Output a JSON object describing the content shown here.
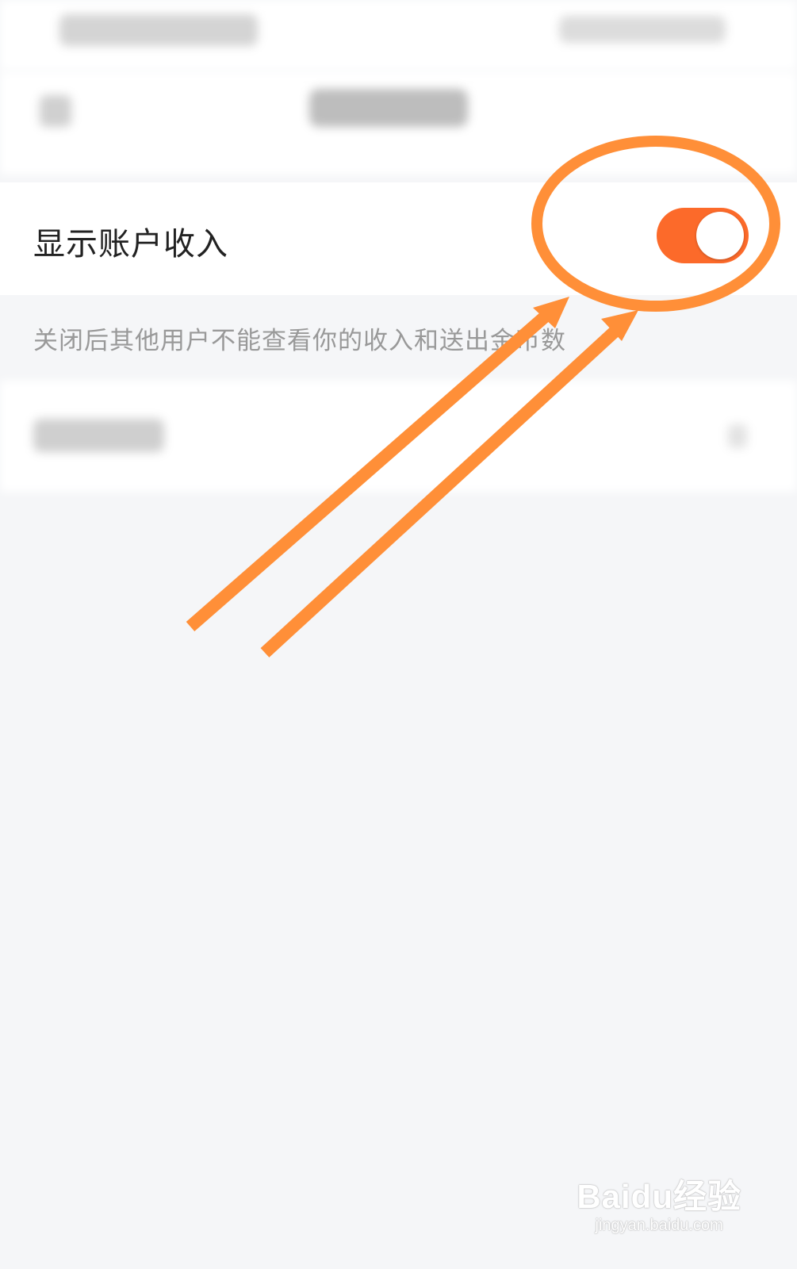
{
  "setting": {
    "label": "显示账户收入",
    "toggle_on": true,
    "accent_color": "#fc6a2a",
    "hint": "关闭后其他用户不能查看你的收入和送出金币数"
  },
  "watermark": {
    "logo": "Baidu经验",
    "url": "jingyan.baidu.com"
  },
  "annotation": {
    "color": "#ff8f38",
    "icons": [
      "highlight-ellipse",
      "arrow",
      "arrow"
    ]
  }
}
